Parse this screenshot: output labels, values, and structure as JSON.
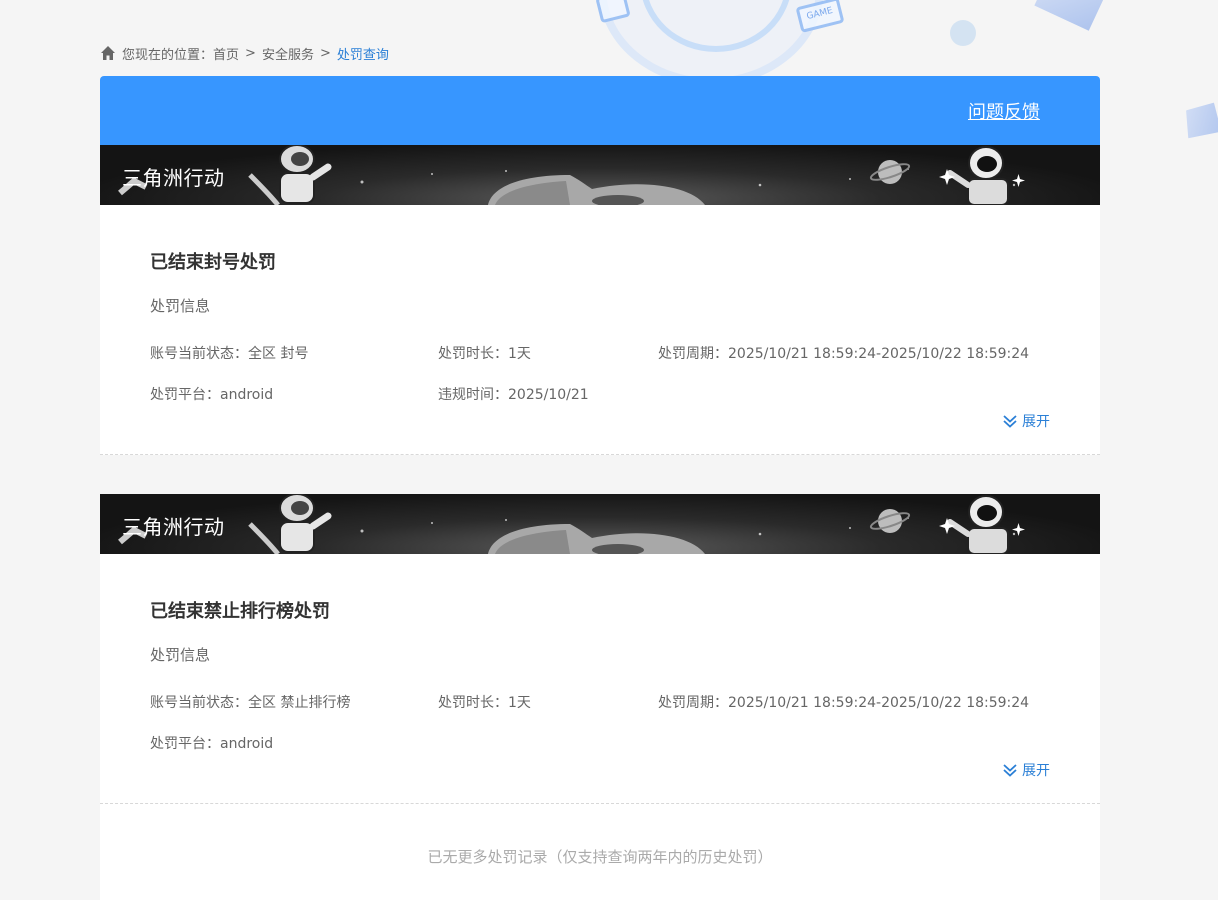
{
  "breadcrumb": {
    "prefix": "您现在的位置：",
    "items": [
      "首页",
      "安全服务"
    ],
    "separator": ">",
    "current": "处罚查询"
  },
  "header": {
    "feedback_label": "问题反馈"
  },
  "records": [
    {
      "game": "三角洲行动",
      "title": "已结束封号处罚",
      "section": "处罚信息",
      "account_status": "账号当前状态：全区 封号",
      "duration": "处罚时长：1天",
      "period": "处罚周期：2025/10/21 18:59:24-2025/10/22 18:59:24",
      "platform": "处罚平台：android",
      "violation_time": "违规时间：2025/10/21",
      "expand_label": "展开"
    },
    {
      "game": "三角洲行动",
      "title": "已结束禁止排行榜处罚",
      "section": "处罚信息",
      "account_status": "账号当前状态：全区 禁止排行榜",
      "duration": "处罚时长：1天",
      "period": "处罚周期：2025/10/21 18:59:24-2025/10/22 18:59:24",
      "platform": "处罚平台：android",
      "expand_label": "展开"
    }
  ],
  "footer": {
    "message": "已无更多处罚记录（仅支持查询两年内的历史处罚）"
  },
  "colors": {
    "accent": "#3796ff",
    "link": "#2a7fd6",
    "banner": "#1a1a1a"
  },
  "decor": {
    "game_badge": "GAME"
  }
}
